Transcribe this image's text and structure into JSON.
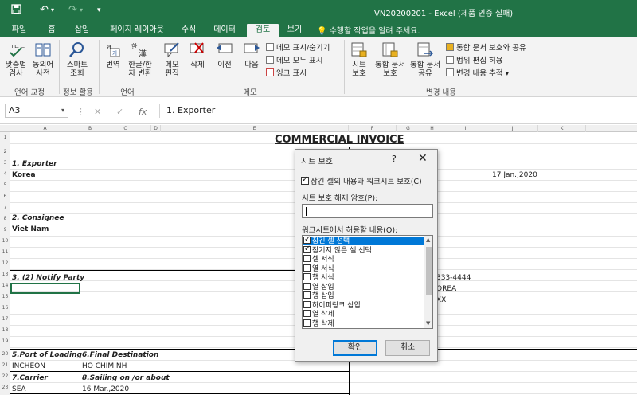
{
  "window": {
    "title": "VN20200201 - Excel (제품 인증 실패)",
    "accent": "#217346",
    "qat": {
      "save_icon": "save-icon",
      "undo_label": "↶",
      "redo_label": "↷",
      "customize_label": "▾"
    }
  },
  "tabs": [
    "파일",
    "홈",
    "삽입",
    "페이지 레이아웃",
    "수식",
    "데이터",
    "검토",
    "보기"
  ],
  "active_tab": "검토",
  "tell_me": "수행할 작업을 알려 주세요.",
  "ribbon": {
    "proofing": {
      "spell_label": "맞춤법\n검사",
      "thesaurus_label": "동의어\n사전",
      "group_label": "언어 교정"
    },
    "insights": {
      "smart_lookup_label": "스마트\n조회",
      "group_label": "정보 활용"
    },
    "language": {
      "translate_label": "번역",
      "convert_label": "한글/한\n자 변환",
      "group_label": "언어"
    },
    "comments": {
      "edit_label": "메모\n편집",
      "delete_label": "삭제",
      "prev_label": "이전",
      "next_label": "다음",
      "show_hide_label": "메모 표시/숨기기",
      "show_all_label": "메모 모두 표시",
      "ink_label": "잉크 표시",
      "group_label": "메모"
    },
    "changes": {
      "protect_sheet_label": "시트\n보호",
      "protect_workbook_label": "통합 문서\n보호",
      "share_workbook_label": "통합 문서\n공유",
      "protect_share_label": "통합 문서 보호와 공유",
      "allow_edit_label": "범위 편집 허용",
      "track_changes_label": "변경 내용 추적",
      "group_label": "변경 내용"
    }
  },
  "formula_bar": {
    "name_box": "A3",
    "cancel": "✕",
    "enter": "✓",
    "fx": "fx",
    "value": "1. Exporter"
  },
  "grid": {
    "columns": [
      "A",
      "B",
      "C",
      "D",
      "E",
      "F",
      "G",
      "H",
      "I",
      "J",
      "K"
    ],
    "rows": [
      "1",
      "2",
      "3",
      "4",
      "5",
      "6",
      "7",
      "8",
      "9",
      "10",
      "11",
      "12",
      "13",
      "14",
      "15",
      "16",
      "17",
      "18",
      "19",
      "20",
      "21",
      "22",
      "23"
    ],
    "invoice_title": "COMMERCIAL INVOICE",
    "exporter_label": "1. Exporter",
    "exporter_value": "Korea",
    "date_value": "17 Jan.,2020",
    "consignee_label": "2. Consignee",
    "consignee_value": "Viet Nam",
    "notify_label": "3. (2) Notify Party",
    "tel_partial": "333-4444",
    "korea_partial": "OREA",
    "xx_partial": "XX",
    "port_loading_label": "5.Port of Loading",
    "port_loading_value": "INCHEON",
    "final_dest_label": "6.Final Destination",
    "final_dest_value": "HO CHIMINH",
    "carrier_label": "7.Carrier",
    "carrier_value": "SEA",
    "sailing_label": "8.Sailing on /or about",
    "sailing_value": "16 Mar.,2020"
  },
  "dialog": {
    "title": "시트 보호",
    "help": "?",
    "close": "✕",
    "protect_contents_label": "잠긴 셀의 내용과 워크시트 보호(C)",
    "protect_contents_checked": true,
    "password_label": "시트 보호 해제 암호(P):",
    "password_value": "",
    "allow_label": "워크시트에서 허용할 내용(O):",
    "permissions": [
      {
        "label": "잠긴 셀 선택",
        "checked": true
      },
      {
        "label": "잠기지 않은 셀 선택",
        "checked": true
      },
      {
        "label": "셀 서식",
        "checked": false
      },
      {
        "label": "열 서식",
        "checked": false
      },
      {
        "label": "행 서식",
        "checked": false
      },
      {
        "label": "열 삽입",
        "checked": false
      },
      {
        "label": "행 삽입",
        "checked": false
      },
      {
        "label": "하이퍼링크 삽입",
        "checked": false
      },
      {
        "label": "열 삭제",
        "checked": false
      },
      {
        "label": "행 삭제",
        "checked": false
      }
    ],
    "ok_label": "확인",
    "cancel_label": "취소"
  }
}
